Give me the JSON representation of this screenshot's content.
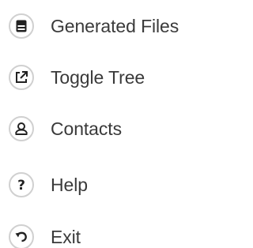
{
  "menu": {
    "items": [
      {
        "label": "Generated Files",
        "icon": "file-stack-icon"
      },
      {
        "label": "Toggle Tree",
        "icon": "external-link-icon"
      },
      {
        "label": "Contacts",
        "icon": "contact-person-icon"
      },
      {
        "label": "Help",
        "icon": "question-mark-icon"
      },
      {
        "label": "Exit",
        "icon": "undo-arrow-icon"
      }
    ]
  },
  "colors": {
    "icon_border": "#d0d0d0",
    "icon_glyph": "#222222",
    "label_text": "#3a3a3a",
    "background": "#ffffff"
  }
}
